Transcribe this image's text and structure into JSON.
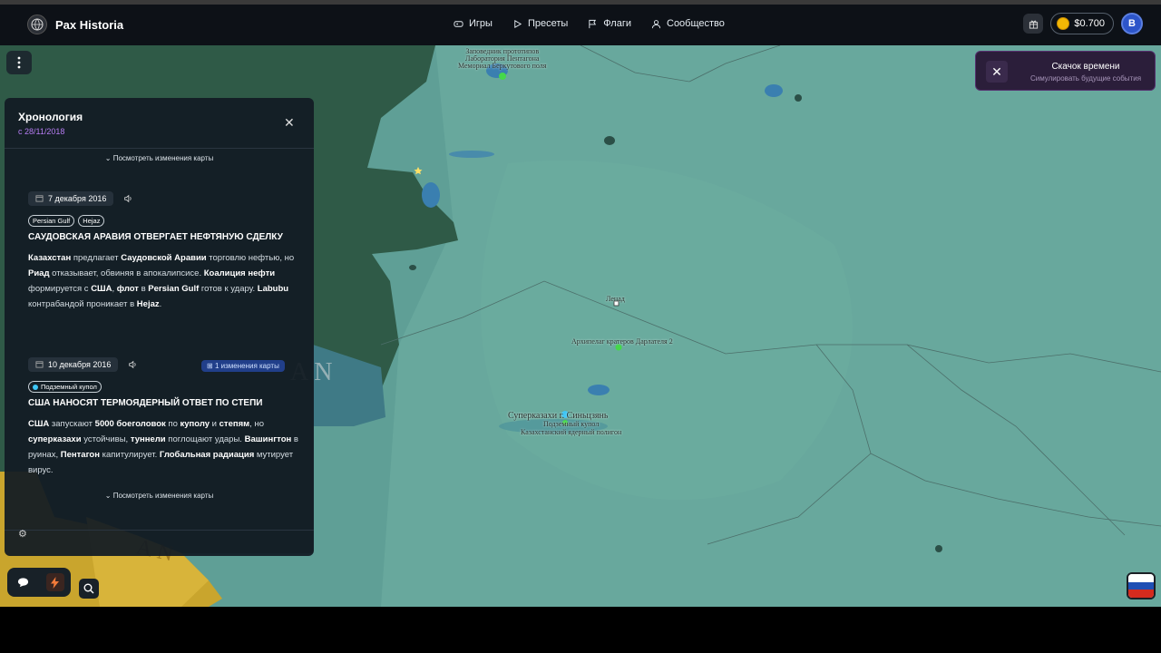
{
  "app": {
    "name": "Pax Historia"
  },
  "nav": {
    "items": [
      {
        "label": "Игры",
        "icon": "gamepad-icon"
      },
      {
        "label": "Пресеты",
        "icon": "play-icon"
      },
      {
        "label": "Флаги",
        "icon": "flag-icon"
      },
      {
        "label": "Сообщество",
        "icon": "community-icon"
      }
    ]
  },
  "account": {
    "balance": "$0.700",
    "avatar_letter": "B"
  },
  "toast": {
    "title": "Скачок времени",
    "subtitle": "Симулировать будущие события"
  },
  "chronology": {
    "title": "Хронология",
    "since": "с 28/11/2018",
    "view_map_changes": "Посмотреть изменения карты",
    "events": [
      {
        "date": "7 декабря 2016",
        "tags": [
          "Persian Gulf",
          "Hejaz"
        ],
        "title": "САУДОВСКАЯ АРАВИЯ ОТВЕРГАЕТ НЕФТЯНУЮ СДЕЛКУ"
      },
      {
        "date": "10 декабря 2016",
        "map_changes": "1 изменения карты",
        "tags": [
          "Подземный купол"
        ],
        "title": "США НАНОСЯТ ТЕРМОЯДЕРНЫЙ ОТВЕТ ПО СТЕПИ"
      }
    ]
  },
  "map": {
    "labels": {
      "north": [
        "Заповедник прототипов",
        "Лаборатория Пентагона",
        "Мемориал Беркутового поля"
      ],
      "city1": "Ленад",
      "city2": "Архипелаг кратеров Дарлателя 2",
      "city3": "Суперказахи г. Синьцзянь",
      "city3_sub": [
        "Подземный купол",
        "Казахстанский ядерный полигон"
      ],
      "region_text1": "AN",
      "region_text2": "AN"
    }
  },
  "colors": {
    "accent_purple": "#b57cf2",
    "map_water": "#5f9f96",
    "map_green_dark": "#2f5a47",
    "map_yellow": "#c9a52d"
  }
}
